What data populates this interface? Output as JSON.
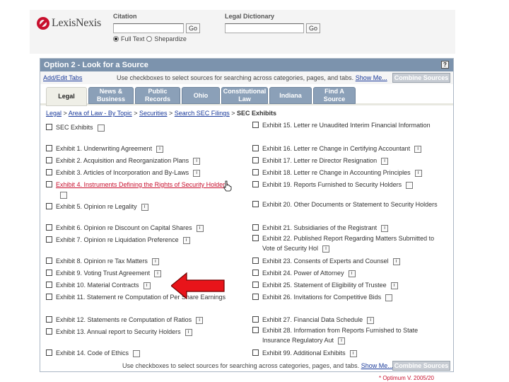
{
  "header": {
    "logo": "LexisNexis",
    "citation_label": "Citation",
    "dictionary_label": "Legal Dictionary",
    "go_label": "Go",
    "radio_full_text": "Full Text",
    "radio_shepardize": "Shepardize"
  },
  "panel": {
    "title": "Option 2 - Look for a Source",
    "help": "?",
    "add_edit_tabs": "Add/Edit Tabs",
    "info_text": "Use checkboxes to select sources for searching across categories, pages, and tabs.",
    "show_me": "Show Me...",
    "combine_sources": "Combine Sources",
    "bottom_info_text": "Use checkboxes to select sources for searching across categories, pages, and tabs.",
    "bottom_show_me": "Show Me..."
  },
  "tabs": [
    {
      "label": "Legal"
    },
    {
      "label": "News & Business"
    },
    {
      "label": "Public Records"
    },
    {
      "label": "Ohio"
    },
    {
      "label": "Constitutional Law"
    },
    {
      "label": "Indiana"
    },
    {
      "label": "Find A Source"
    }
  ],
  "breadcrumb": {
    "legal": "Legal",
    "sep": " > ",
    "area": "Area of Law - By Topic",
    "securities": "Securities",
    "search": "Search SEC Filings",
    "current": "SEC Exhibits"
  },
  "left_items": [
    {
      "label": "SEC Exhibits"
    },
    {
      "label": "Exhibit 1. Underwriting Agreement"
    },
    {
      "label": "Exhibit 2. Acquisition and Reorganization Plans"
    },
    {
      "label": "Exhibit 3. Articles of Incorporation and By-Laws"
    },
    {
      "label": "Exhibit 4. Instruments Defining the Rights of Security Holders"
    },
    {
      "label": "Exhibit 5. Opinion re Legality"
    },
    {
      "label": "Exhibit 6. Opinion re Discount on Capital Shares"
    },
    {
      "label": "Exhibit 7. Opinion re Liquidation Preference"
    },
    {
      "label": "Exhibit 8. Opinion re Tax Matters"
    },
    {
      "label": "Exhibit 9. Voting Trust Agreement"
    },
    {
      "label": "Exhibit 10. Material Contracts"
    },
    {
      "label": "Exhibit 11. Statement re Computation of Per Share Earnings"
    },
    {
      "label": "Exhibit 12. Statements re Computation of Ratios"
    },
    {
      "label": "Exhibit 13. Annual report to Security Holders"
    },
    {
      "label": "Exhibit 14. Code of Ethics"
    }
  ],
  "right_items": [
    {
      "label": "Exhibit 15. Letter re Unaudited Interim Financial Information"
    },
    {
      "label": "Exhibit 16. Letter re Change in Certifying Accountant"
    },
    {
      "label": "Exhibit 17. Letter re Director Resignation"
    },
    {
      "label": "Exhibit 18. Letter re Change in Accounting Principles"
    },
    {
      "label": "Exhibit 19. Reports Furnished to Security Holders"
    },
    {
      "label": "Exhibit 20. Other Documents or Statement to Security Holders"
    },
    {
      "label": "Exhibit 21. Subsidiaries of the Registrant"
    },
    {
      "label": "Exhibit 22. Published Report Regarding Matters Submitted to Vote of Security Hol"
    },
    {
      "label": "Exhibit 23. Consents of Experts and Counsel"
    },
    {
      "label": "Exhibit 24. Power of Attorney"
    },
    {
      "label": "Exhibit 25. Statement of Eligibility of Trustee"
    },
    {
      "label": "Exhibit 26. Invitations for Competitive Bids"
    },
    {
      "label": "Exhibit 27. Financial Data Schedule"
    },
    {
      "label": "Exhibit 28. Information from Reports Furnished to State Insurance Regulatory Aut"
    },
    {
      "label": "Exhibit 99. Additional Exhibits"
    }
  ],
  "icons": {
    "info": "i"
  },
  "colors": {
    "brand_red": "#c8102e",
    "tab_blue": "#8ba0b8",
    "title_blue": "#7c93ad",
    "link_blue": "#1a3a9a"
  },
  "footer": "* Optimum V. 2005/20"
}
